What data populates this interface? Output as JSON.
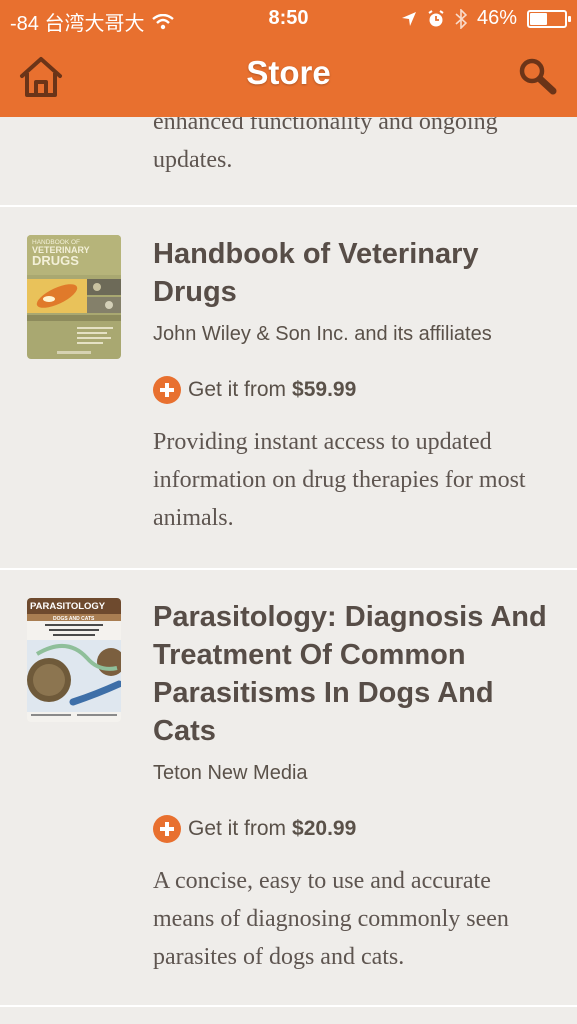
{
  "status_bar": {
    "carrier": "-84 台湾大哥大",
    "time": "8:50",
    "battery": "46%",
    "battery_level": 0.46
  },
  "nav": {
    "title": "Store",
    "home_icon": "home-icon",
    "search_icon": "search-icon"
  },
  "partial_item": {
    "description": "enhanced functionality and ongoing updates."
  },
  "products": [
    {
      "title": "Handbook of Veterinary Drugs",
      "publisher": "John Wiley & Son Inc. and its affiliates",
      "price_prefix": "Get it from",
      "price": "$59.99",
      "description": "Providing instant access to updated information on drug therapies for most animals.",
      "cover": {
        "line1": "HANDBOOK OF",
        "line2": "VETERINARY",
        "line3": "DRUGS"
      }
    },
    {
      "title": "Parasitology: Diagnosis And Treatment Of Common Parasitisms In Dogs And Cats",
      "publisher": "Teton New Media",
      "price_prefix": "Get it from",
      "price": "$20.99",
      "description": "A concise, easy to use and accurate means of diagnosing commonly seen parasites of dogs and cats.",
      "cover": {
        "line1": "PARASITOLOGY",
        "line2": "DOGS AND CATS"
      }
    }
  ],
  "colors": {
    "accent": "#e8702f",
    "background": "#efedea",
    "text": "#574d47"
  }
}
